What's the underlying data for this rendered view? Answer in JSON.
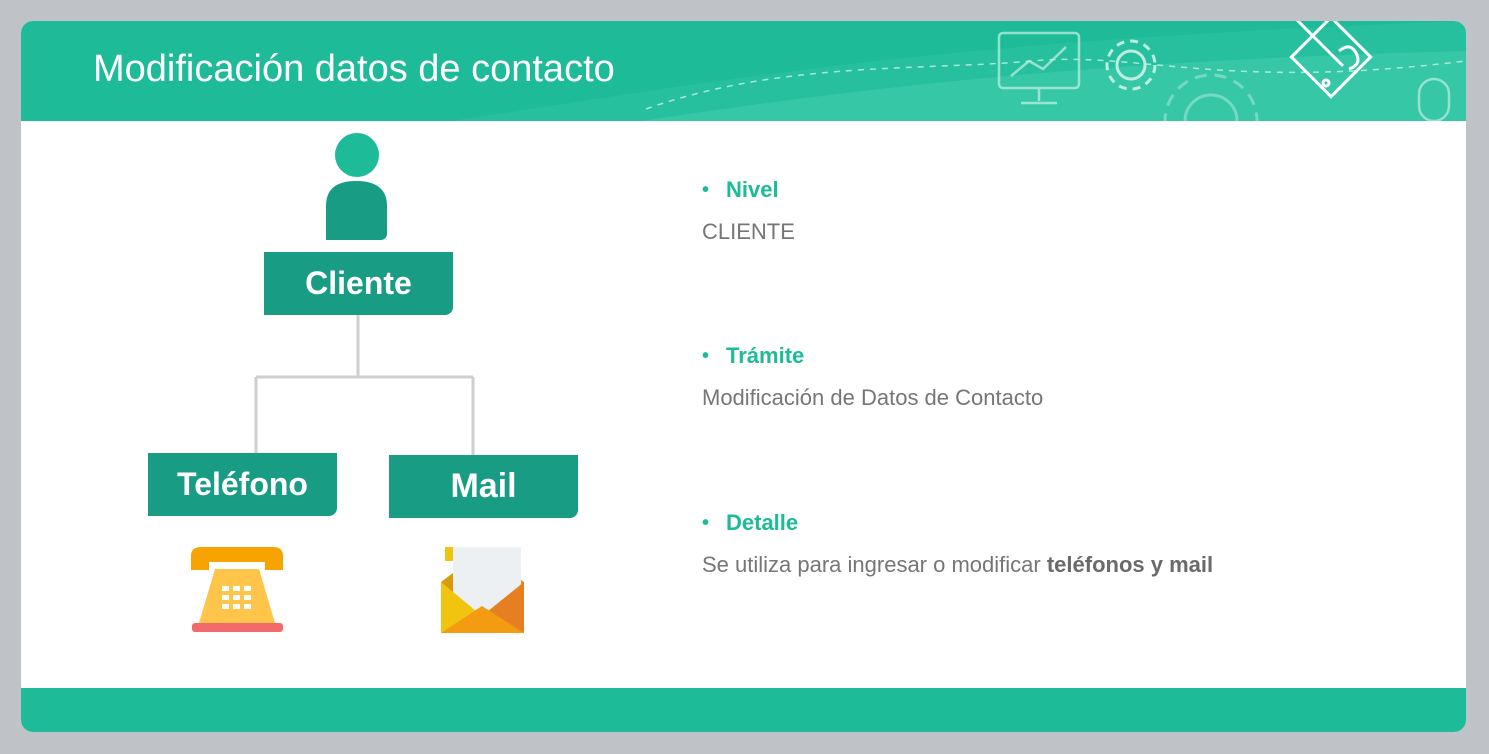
{
  "header": {
    "title": "Modificación datos de contacto"
  },
  "diagram": {
    "root": {
      "label": "Cliente"
    },
    "children": [
      {
        "label": "Teléfono",
        "icon": "telephone-icon"
      },
      {
        "label": "Mail",
        "icon": "envelope-icon"
      }
    ]
  },
  "info": {
    "nivel": {
      "label": "Nivel",
      "value": "CLIENTE"
    },
    "tramite": {
      "label": "Trámite",
      "value": "Modificación de Datos de Contacto"
    },
    "detalle": {
      "label": "Detalle",
      "value_prefix": "Se utiliza para ingresar o modificar ",
      "value_bold": "teléfonos y mail"
    }
  },
  "colors": {
    "accent": "#1dbb98",
    "node": "#189c84",
    "text_gray": "#767676",
    "background": "#bfc3c7"
  },
  "icons": [
    "person-icon",
    "telephone-icon",
    "envelope-icon",
    "monitor-icon",
    "gear-icon",
    "pencil-puzzle-icon",
    "mouse-icon"
  ]
}
